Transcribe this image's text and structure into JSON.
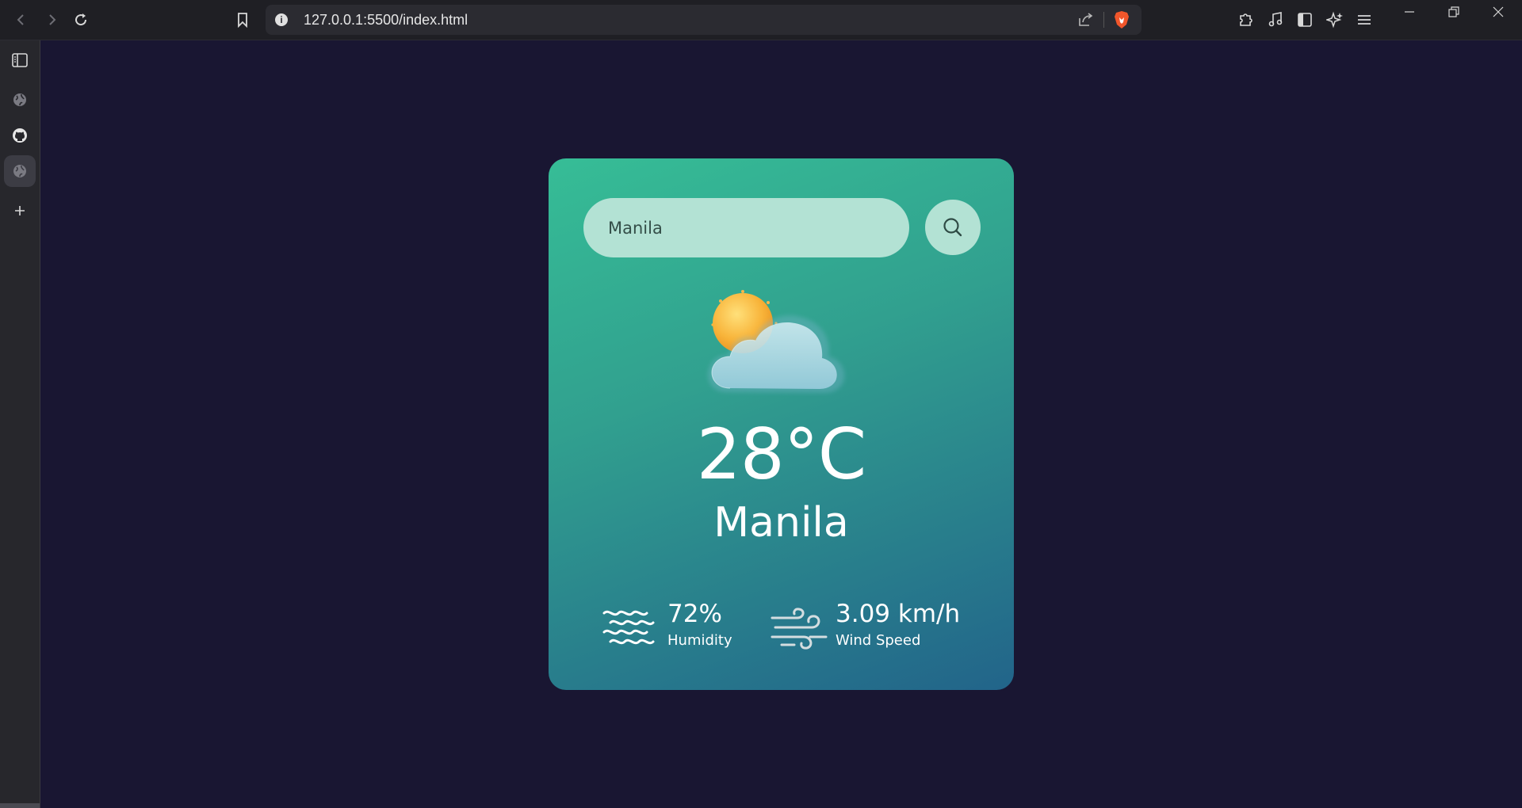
{
  "browser": {
    "url": "127.0.0.1:5500/index.html"
  },
  "weather": {
    "search_value": "Manila",
    "temperature": "28°C",
    "city": "Manila",
    "humidity_value": "72%",
    "humidity_label": "Humidity",
    "wind_value": "3.09 km/h",
    "wind_label": "Wind Speed",
    "condition_icon": "partly-cloudy-icon"
  },
  "colors": {
    "page_background": "#191632",
    "card_gradient_start": "#36bd96",
    "card_gradient_end": "#22648a",
    "input_background": "#b3e2d4"
  }
}
